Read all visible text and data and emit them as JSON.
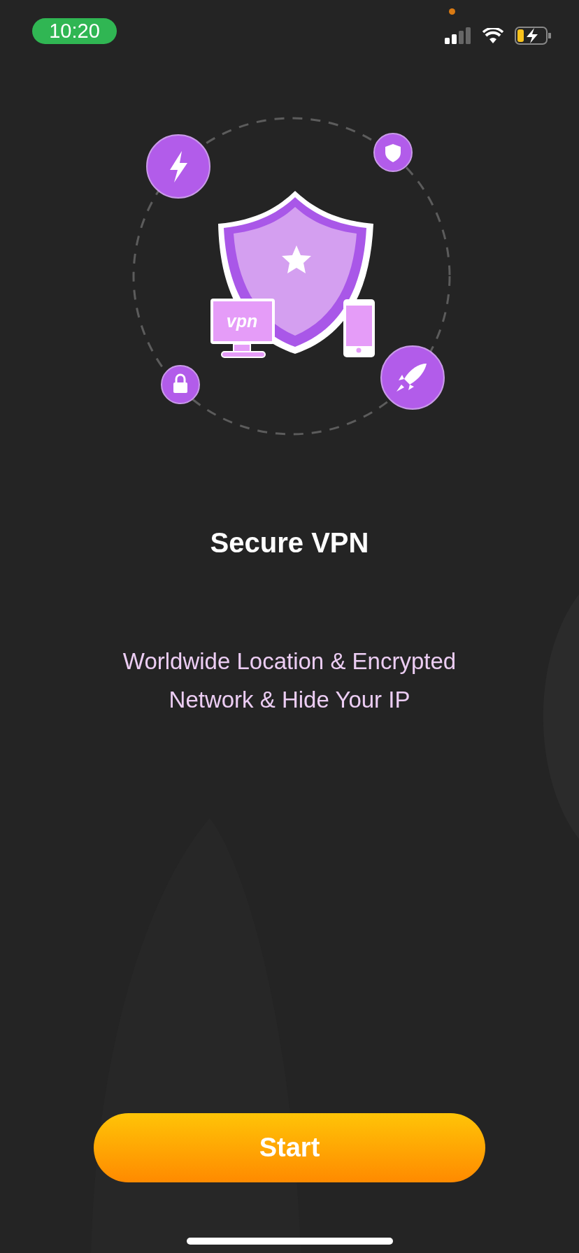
{
  "status_bar": {
    "time": "10:20"
  },
  "illustration": {
    "label": "vpn"
  },
  "title": "Secure VPN",
  "subtitle": "Worldwide Location & Encrypted Network & Hide Your IP",
  "start_button": {
    "label": "Start"
  }
}
